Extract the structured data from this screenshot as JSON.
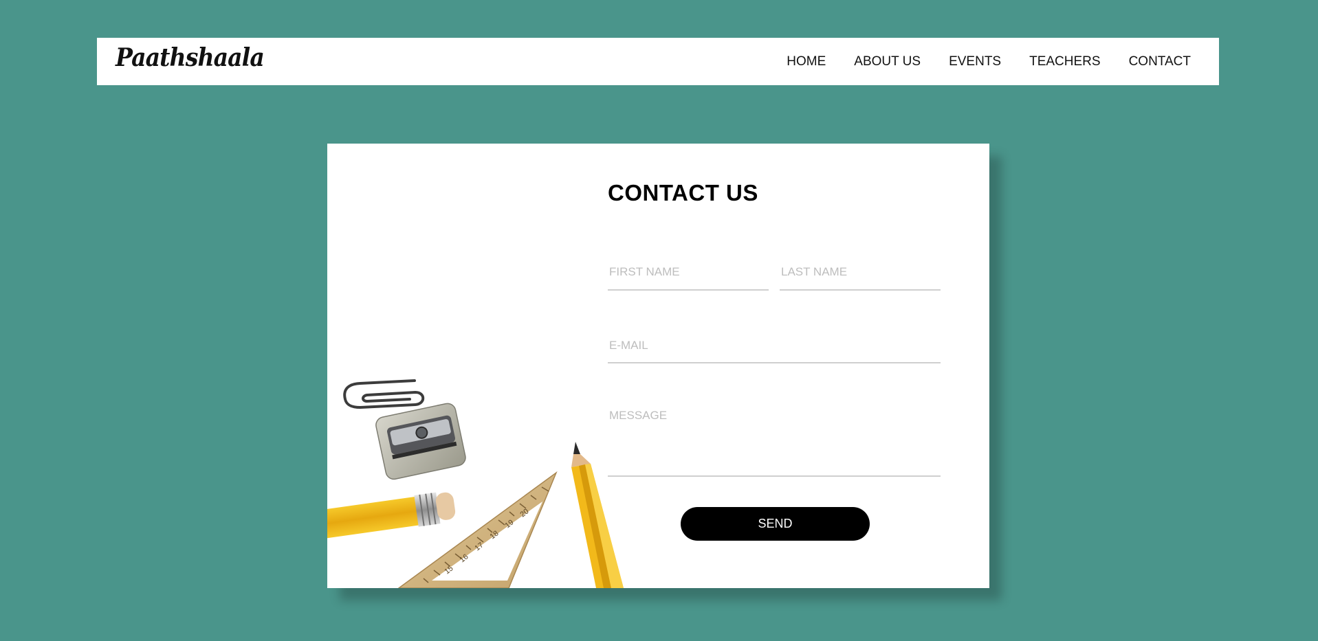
{
  "header": {
    "logo": "Paathshaala",
    "nav": [
      "HOME",
      "ABOUT US",
      "EVENTS",
      "TEACHERS",
      "CONTACT"
    ]
  },
  "contact": {
    "title": "CONTACT US",
    "first_name_placeholder": "FIRST NAME",
    "last_name_placeholder": "LAST NAME",
    "email_placeholder": "E-MAIL",
    "message_placeholder": "MESSAGE",
    "send_label": "SEND"
  },
  "illustration": {
    "ruler_marks": [
      "15",
      "16",
      "17",
      "18",
      "19",
      "20"
    ]
  },
  "colors": {
    "background": "#4a958b",
    "card": "#ffffff",
    "button": "#000000",
    "pencil": "#f1b91c"
  }
}
